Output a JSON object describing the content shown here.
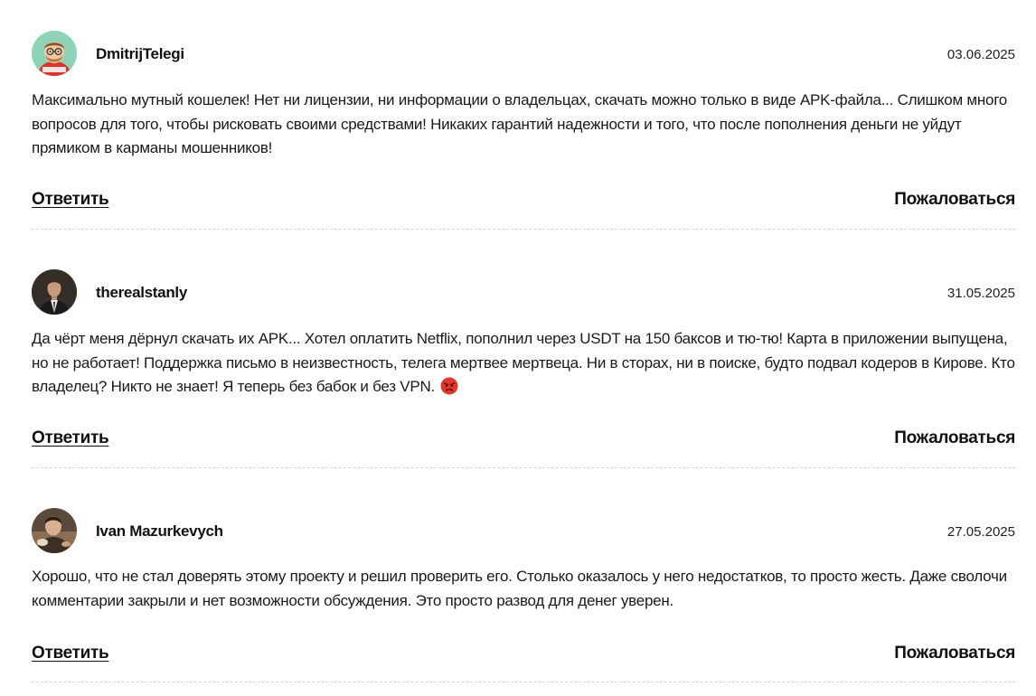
{
  "comments": [
    {
      "author": "DmitrijTelegi",
      "date": "03.06.2025",
      "text": "Максимально мутный кошелек! Нет ни лицензии, ни информации о владельцах, скачать можно только в виде APK-файла... Слишком много вопросов для того, чтобы рисковать своими средствами! Никаких гарантий надежности и того, что после пополнения деньги не уйдут прямиком в карманы мошенников!",
      "avatar_icon": "cartoon-man-avatar-icon",
      "reply_label": "Ответить",
      "report_label": "Пожаловаться"
    },
    {
      "author": "therealstanly",
      "date": "31.05.2025",
      "text": "Да чёрт меня дёрнул скачать их APK... Хотел оплатить Netflix, пополнил через USDT на 150 баксов и тю-тю! Карта в приложении выпущена, но не работает! Поддержка письмо в неизвестность, телега мертвее мертвеца. Ни в сторах, ни в поиске, будто подвал кодеров в Кирове. Кто владелец? Никто не знает! Я теперь без бабок и без VPN.",
      "emoji": "angry-face-emoji",
      "avatar_icon": "man-in-suit-avatar-icon",
      "reply_label": "Ответить",
      "report_label": "Пожаловаться"
    },
    {
      "author": "Ivan Mazurkevych",
      "date": "27.05.2025",
      "text": "Хорошо, что не стал доверять этому проекту и решил проверить его. Столько оказалось у него недостатков, то просто жесть. Даже сволочи комментарии закрыли и нет возможности обсуждения. Это просто развод для денег уверен.",
      "avatar_icon": "man-photo-avatar-icon",
      "reply_label": "Ответить",
      "report_label": "Пожаловаться"
    }
  ],
  "colors": {
    "text": "#111111",
    "divider": "#d6d6d6",
    "avatar1_bg": "#8fd3b6",
    "emoji": "#e0392b"
  }
}
